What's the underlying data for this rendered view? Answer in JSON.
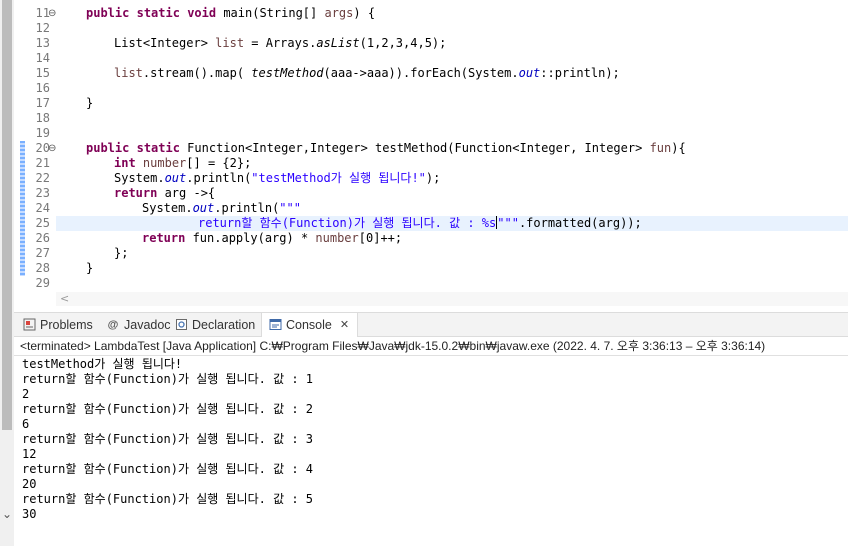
{
  "editor": {
    "lines": [
      {
        "num": "11",
        "code": "main_decl",
        "fold": true
      },
      {
        "num": "12"
      },
      {
        "num": "13",
        "code": "list_decl"
      },
      {
        "num": "14"
      },
      {
        "num": "15",
        "code": "stream"
      },
      {
        "num": "16"
      },
      {
        "num": "17",
        "code": "close1"
      },
      {
        "num": "18"
      },
      {
        "num": "19"
      },
      {
        "num": "20",
        "code": "fn_decl",
        "fold": true
      },
      {
        "num": "21",
        "code": "int_arr"
      },
      {
        "num": "22",
        "code": "println1"
      },
      {
        "num": "23",
        "code": "ret_lambda"
      },
      {
        "num": "24",
        "code": "println2"
      },
      {
        "num": "25",
        "code": "textblock"
      },
      {
        "num": "26",
        "code": "ret_apply"
      },
      {
        "num": "27",
        "code": "close_lambda"
      },
      {
        "num": "28",
        "code": "close2"
      },
      {
        "num": "29"
      }
    ],
    "tokens": {
      "public": "public",
      "static": "static",
      "void": "void",
      "int": "int",
      "return": "return",
      "main_sig": " main(String[] ",
      "args": "args",
      "main_tail": ") {",
      "list_type": "List<Integer> ",
      "list_var": "list",
      "list_assign": " = Arrays.",
      "aslist": "asList",
      "aslist_args": "(1,2,3,4,5);",
      "stream_a": ".stream().map( ",
      "testmethod": "testMethod",
      "stream_b": "(aaa->aaa)).forEach(System.",
      "out": "out",
      "stream_c": "::println);",
      "brace_close": "}",
      "fn_type": " Function<Integer,Integer> testMethod(Function<Integer, Integer> ",
      "fun": "fun",
      "fn_tail": "){",
      "number": "number",
      "int_arr_tail": "[] = {2};",
      "system": "System.",
      "println_open": ".println(",
      "str1": "\"testMethod가 실행 됩니다!\"",
      "println_close": ");",
      "ret_lambda_tail": " arg ->{",
      "tb_open": "\"\"\"",
      "tb_content": "return할 함수(Function)가 실행 됩니다. 값 : %s",
      "tb_close": "\"\"\"",
      "formatted": ".formatted(arg));",
      "ret_apply_a": " fun.apply(arg) * ",
      "ret_apply_b": "[0]++;",
      "close_lambda": "};"
    }
  },
  "tabs": [
    {
      "label": "Problems",
      "icon": "problems-icon"
    },
    {
      "label": "Javadoc",
      "icon": "javadoc-icon",
      "glyph": "@"
    },
    {
      "label": "Declaration",
      "icon": "declaration-icon"
    },
    {
      "label": "Console",
      "icon": "console-icon"
    }
  ],
  "console": {
    "header": "<terminated> LambdaTest [Java Application] C:₩Program Files₩Java₩jdk-15.0.2₩bin₩javaw.exe  (2022. 4. 7. 오후 3:36:13 – 오후 3:36:14)",
    "output": [
      "testMethod가 실행 됩니다!",
      "return할 함수(Function)가 실행 됩니다. 값 : 1",
      "2",
      "return할 함수(Function)가 실행 됩니다. 값 : 2",
      "6",
      "return할 함수(Function)가 실행 됩니다. 값 : 3",
      "12",
      "return할 함수(Function)가 실행 됩니다. 값 : 4",
      "20",
      "return할 함수(Function)가 실행 됩니다. 값 : 5",
      "30"
    ]
  },
  "colors": {
    "keyword": "#7f0055",
    "string": "#2a00ff",
    "static_field": "#0000c0",
    "local_var": "#6a3e3e",
    "line_number": "#787878",
    "current_line": "#e8f2fe"
  }
}
